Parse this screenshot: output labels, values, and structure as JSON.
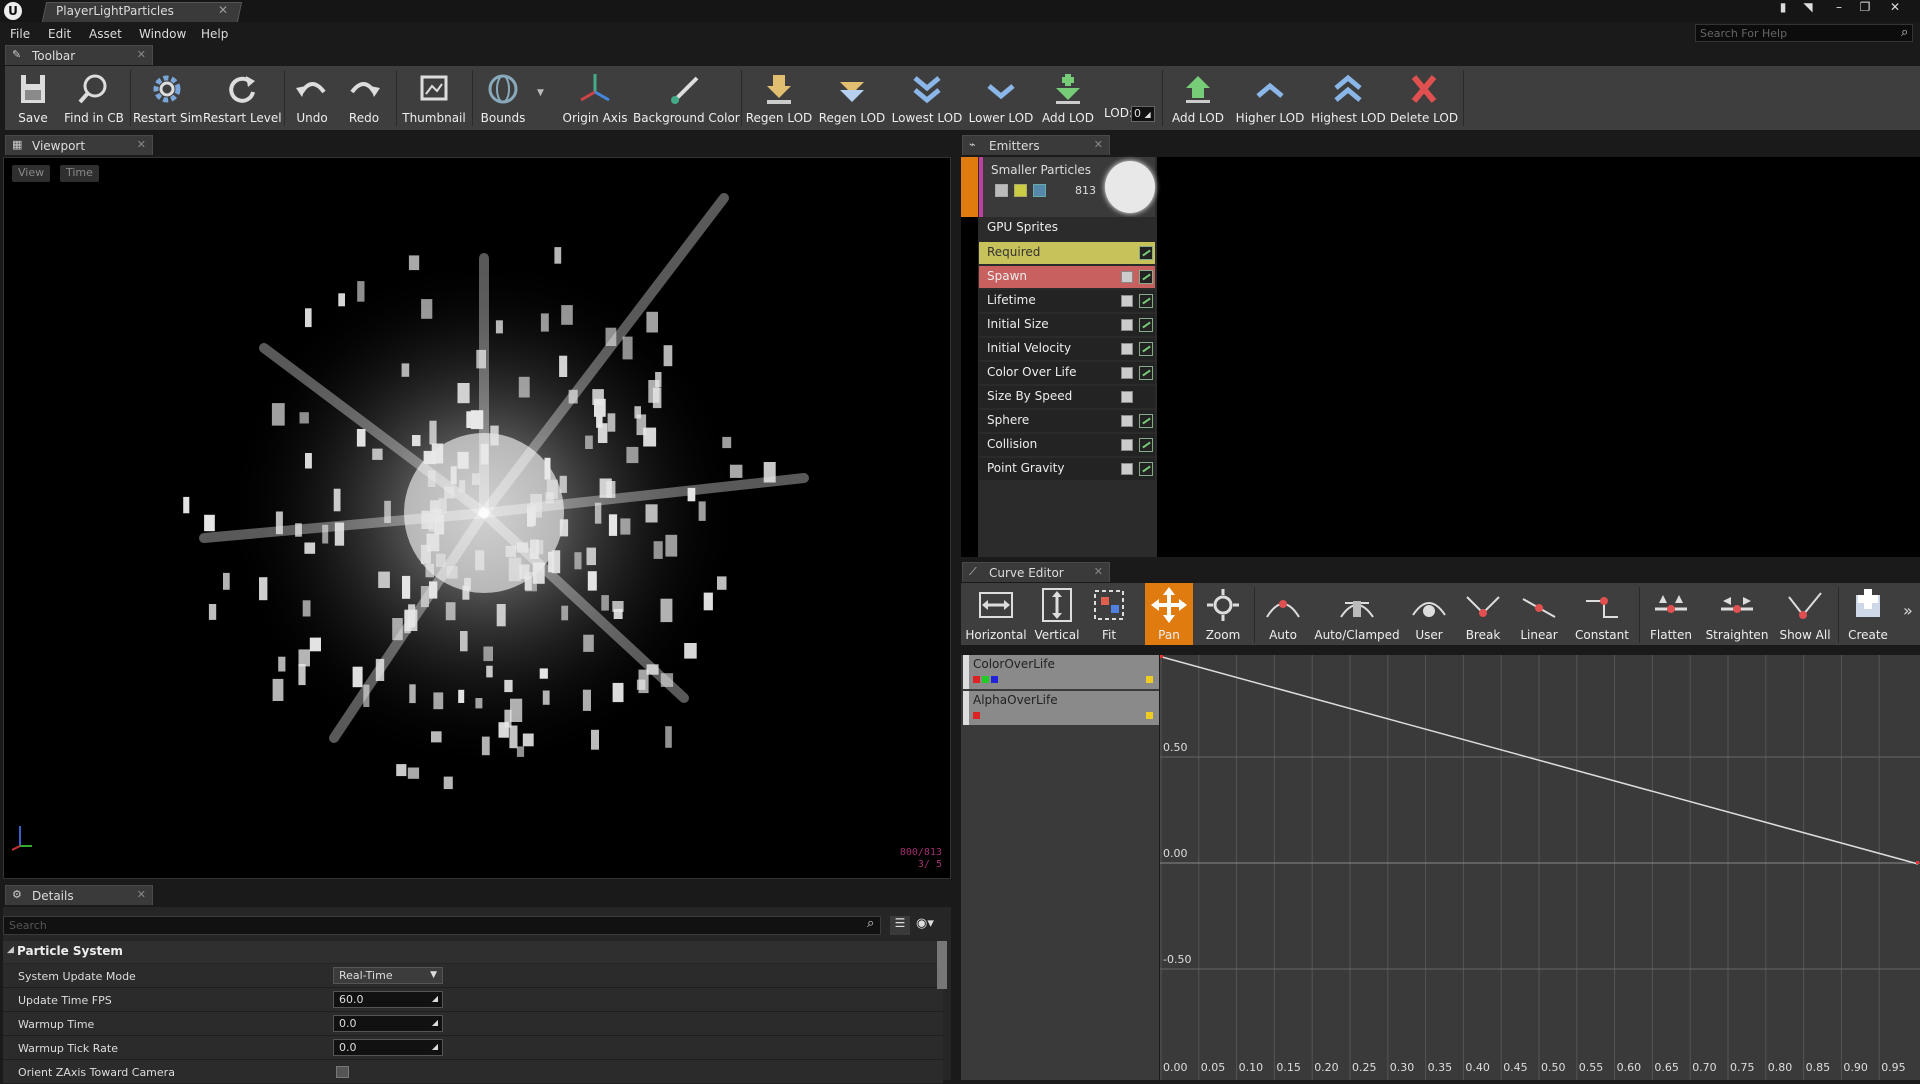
{
  "window": {
    "doc_tab": "PlayerLightParticles",
    "help_search_placeholder": "Search For Help"
  },
  "menu": [
    "File",
    "Edit",
    "Asset",
    "Window",
    "Help"
  ],
  "panels": {
    "toolbar": "Toolbar",
    "viewport": "Viewport",
    "emitters": "Emitters",
    "curve_editor": "Curve Editor",
    "details": "Details"
  },
  "toolbar": {
    "buttons": [
      "Save",
      "Find in CB",
      "Restart Sim",
      "Restart Level",
      "Undo",
      "Redo",
      "Thumbnail",
      "Bounds",
      "Origin Axis",
      "Background Color",
      "Regen LOD",
      "Regen LOD",
      "Lowest LOD",
      "Lower LOD",
      "Add LOD",
      "Add LOD",
      "Higher LOD",
      "Highest LOD",
      "Delete LOD"
    ],
    "lod_label": "LOD:",
    "lod_value": "0"
  },
  "viewport": {
    "view_btn": "View",
    "time_btn": "Time",
    "stats_line1": "800/813",
    "stats_line2": "3/ 5"
  },
  "emitter": {
    "name": "Smaller Particles",
    "count": "813",
    "type": "GPU Sprites",
    "modules": [
      "Required",
      "Spawn",
      "Lifetime",
      "Initial Size",
      "Initial Velocity",
      "Color Over Life",
      "Size By Speed",
      "Sphere",
      "Collision",
      "Point Gravity"
    ]
  },
  "curve_editor": {
    "buttons": [
      "Horizontal",
      "Vertical",
      "Fit",
      "Pan",
      "Zoom",
      "Auto",
      "Auto/Clamped",
      "User",
      "Break",
      "Linear",
      "Constant",
      "Flatten",
      "Straighten",
      "Show All",
      "Create"
    ],
    "curves": [
      "ColorOverLife",
      "AlphaOverLife"
    ],
    "y_labels": [
      "0.50",
      "0.00",
      "-0.50"
    ],
    "x_labels": [
      "0.00",
      "0.05",
      "0.10",
      "0.15",
      "0.20",
      "0.25",
      "0.30",
      "0.35",
      "0.40",
      "0.45",
      "0.50",
      "0.55",
      "0.60",
      "0.65",
      "0.70",
      "0.75",
      "0.80",
      "0.85",
      "0.90",
      "0.95"
    ]
  },
  "details": {
    "search_placeholder": "Search",
    "category": "Particle System",
    "properties": [
      {
        "label": "System Update Mode",
        "value": "Real-Time"
      },
      {
        "label": "Update Time FPS",
        "value": "60.0"
      },
      {
        "label": "Warmup Time",
        "value": "0.0"
      },
      {
        "label": "Warmup Tick Rate",
        "value": "0.0"
      },
      {
        "label": "Orient ZAxis Toward Camera",
        "value": ""
      }
    ]
  },
  "colors": {
    "accent_orange": "#e07b10",
    "required_row": "#c7c35a",
    "spawn_row": "#c86060",
    "emitter_stripe": "#c040a0"
  }
}
